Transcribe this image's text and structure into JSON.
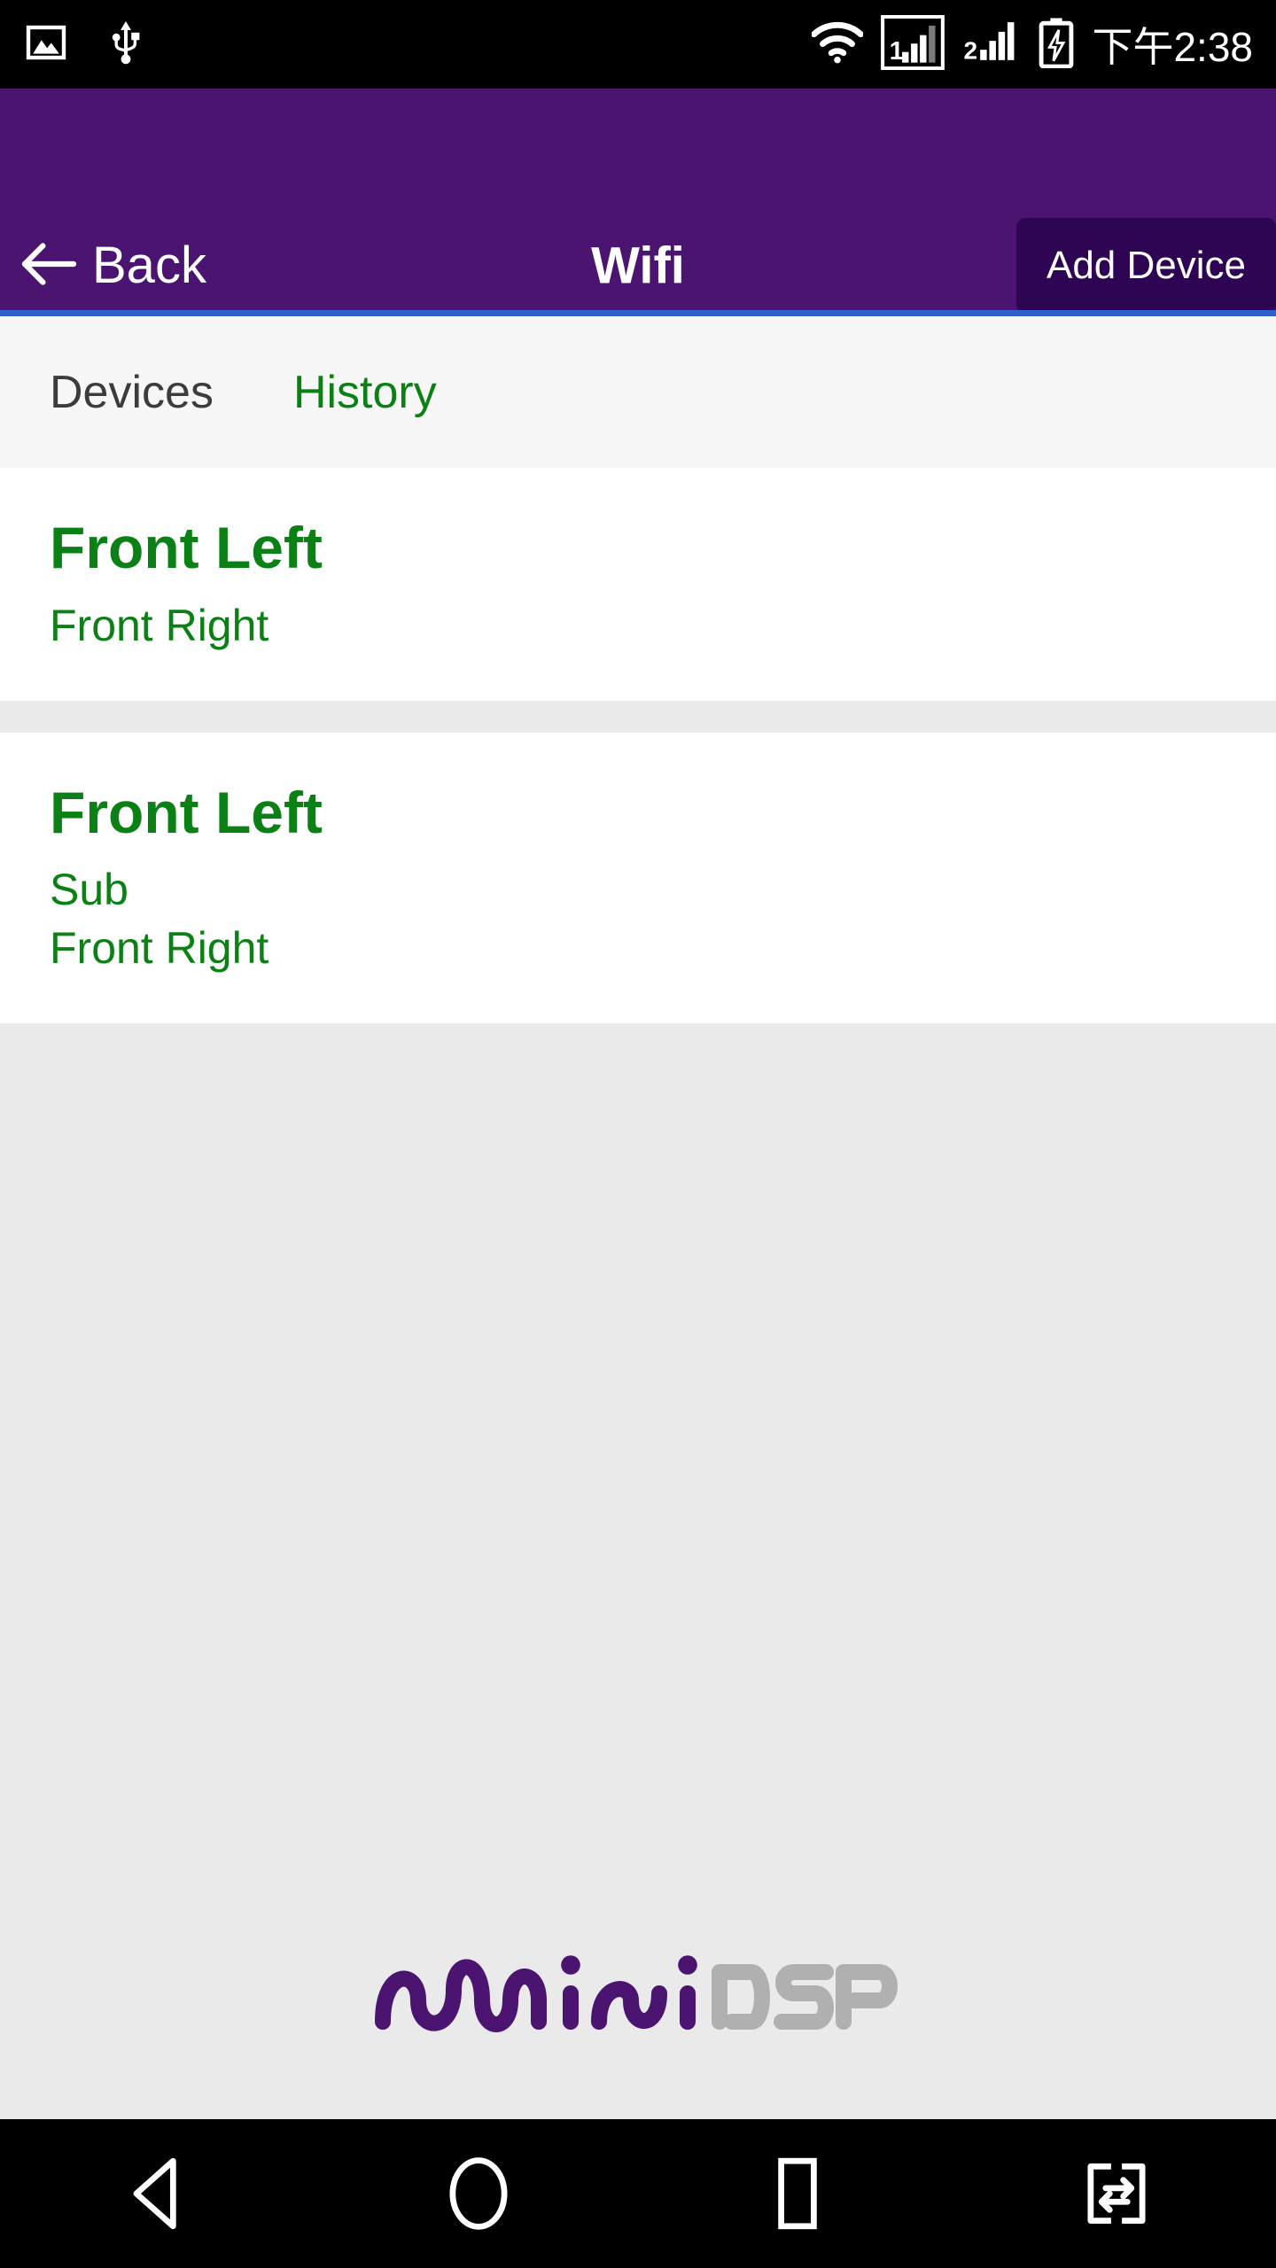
{
  "statusbar": {
    "time": "下午2:38",
    "left_icons": [
      {
        "name": "screenshot-image-icon"
      },
      {
        "name": "usb-icon"
      }
    ],
    "right_icons": [
      {
        "name": "wifi-icon"
      },
      {
        "name": "sim1-signal-icon",
        "label": "1"
      },
      {
        "name": "sim2-signal-icon",
        "label": "2"
      },
      {
        "name": "battery-charging-icon"
      }
    ]
  },
  "header": {
    "back_label": "Back",
    "title": "Wifi",
    "add_device_label": "Add Device",
    "bg_color": "#4a1470",
    "button_color": "#2e0553",
    "accent_line_color": "#2f5fd0"
  },
  "tabs": [
    {
      "label": "Devices",
      "active": false
    },
    {
      "label": "History",
      "active": true
    }
  ],
  "devices": [
    {
      "title": "Front Left",
      "sublines": [
        "Front Right"
      ]
    },
    {
      "title": "Front Left",
      "sublines": [
        "Sub",
        "Front Right"
      ]
    }
  ],
  "colors": {
    "green_text": "#0b8014",
    "tab_inactive": "#3c3c3c",
    "page_bg": "#eaeaea",
    "card_bg": "#ffffff",
    "tabbar_bg": "#f7f7f7"
  },
  "logo": {
    "name": "minidsp-logo",
    "text_primary": "mini",
    "text_secondary": "DSP",
    "primary_color": "#4a1470",
    "secondary_color": "#b0b0b0"
  },
  "navbar": [
    {
      "name": "nav-back-icon"
    },
    {
      "name": "nav-home-icon"
    },
    {
      "name": "nav-recents-icon"
    },
    {
      "name": "nav-split-screen-icon"
    }
  ]
}
